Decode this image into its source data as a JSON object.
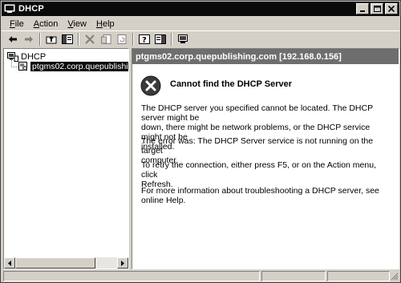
{
  "window": {
    "title": "DHCP",
    "app_icon": "dhcp-console-icon"
  },
  "caption_buttons": [
    {
      "name": "minimize-button",
      "icon": "minimize-icon"
    },
    {
      "name": "maximize-button",
      "icon": "maximize-icon"
    },
    {
      "name": "close-button",
      "icon": "close-icon"
    }
  ],
  "menu": {
    "file": {
      "acc": "F",
      "rest": "ile"
    },
    "action": {
      "acc": "A",
      "rest": "ction"
    },
    "view": {
      "acc": "V",
      "rest": "iew"
    },
    "help": {
      "acc": "H",
      "rest": "elp"
    }
  },
  "toolbar": {
    "icons": [
      "back-icon",
      "forward-icon",
      "up-one-level-icon",
      "show-hide-tree-icon",
      "delete-icon",
      "properties-icon",
      "refresh-icon",
      "help-icon",
      "show-hide-action-pane-icon",
      "monitor-icon"
    ]
  },
  "tree": {
    "root_label": "DHCP",
    "server_label": "ptgms02.corp.quepublishing.com"
  },
  "right_pane": {
    "header": "ptgms02.corp.quepublishing.com [192.168.0.156]",
    "error_title": "Cannot find the DHCP Server",
    "para1_line1": "The DHCP server you specified cannot be located. The DHCP server might be",
    "para1_line2": "down, there might be network problems, or the DHCP service might not be",
    "para1_line3": "installed.",
    "para2_line1": "The error was:  The DHCP Server service is not running on the target",
    "para2_line2": "computer.",
    "para3_line1": "To retry the connection, either press F5, or on the Action menu, click",
    "para3_line2": "Refresh.",
    "para4_line1": "For more information about troubleshooting a DHCP server, see online Help."
  },
  "colors": {
    "titlebar": "#0a0a0a",
    "chrome": "#d4d0c8",
    "header": "#6e6e6e",
    "selection": "#0a0a0a"
  }
}
